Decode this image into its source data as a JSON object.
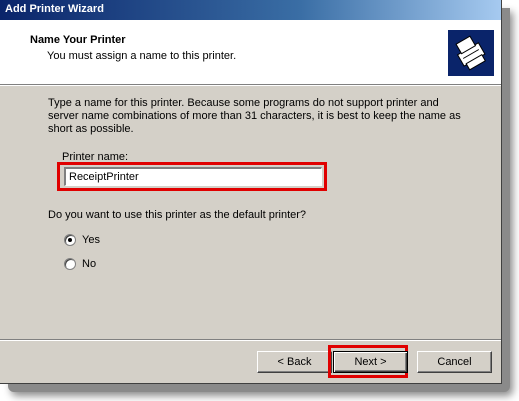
{
  "window": {
    "title": "Add Printer Wizard"
  },
  "header": {
    "title": "Name Your Printer",
    "subtitle": "You must assign a name to this printer."
  },
  "main": {
    "description": "Type a name for this printer. Because some programs do not support printer and server name combinations of more than 31 characters, it is best to keep the name as short as possible.",
    "printer_name_label": "Printer name:",
    "printer_name_value": "ReceiptPrinter",
    "default_question": "Do you want to use this printer as the default printer?",
    "radios": [
      {
        "label": "Yes",
        "checked": true
      },
      {
        "label": "No",
        "checked": false
      }
    ]
  },
  "footer": {
    "back_label": "< Back",
    "next_label": "Next >",
    "cancel_label": "Cancel"
  },
  "colors": {
    "title_bar_start": "#0a246a",
    "title_bar_end": "#a6caf0",
    "highlight": "#e00000",
    "dialog_face": "#d4d0c8"
  },
  "icons": {
    "header_icon": "printer-icon"
  }
}
